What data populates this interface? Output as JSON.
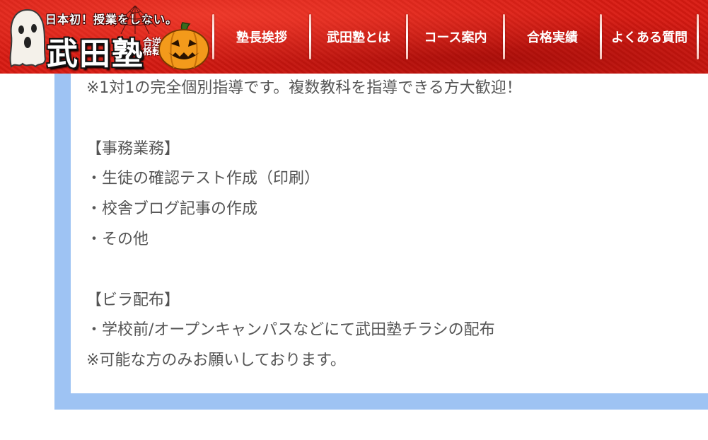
{
  "header": {
    "logo": {
      "tagline": "日本初！授業をしない。",
      "name": "武田塾",
      "sub": "合逆格転"
    },
    "nav": {
      "items": [
        {
          "label": "塾長挨拶"
        },
        {
          "label": "武田塾とは"
        },
        {
          "label": "コース案内"
        },
        {
          "label": "合格実績"
        },
        {
          "label": "よくある質問"
        }
      ]
    },
    "colors": {
      "header_bg": "#d81a12",
      "frame": "#9ec3f3",
      "text": "#555555"
    }
  },
  "main": {
    "lines": [
      "※1対1の完全個別指導です。複数教科を指導できる方大歓迎！",
      "",
      "【事務業務】",
      "・生徒の確認テスト作成（印刷）",
      "・校舎ブログ記事の作成",
      "・その他",
      "",
      "【ビラ配布】",
      "・学校前/オープンキャンパスなどにて武田塾チラシの配布",
      "※可能な方のみお願いしております。"
    ]
  },
  "icons": {
    "ghost": "ghost-icon",
    "spider_web": "spider-web-icon",
    "pumpkin": "jack-o-lantern-icon"
  }
}
